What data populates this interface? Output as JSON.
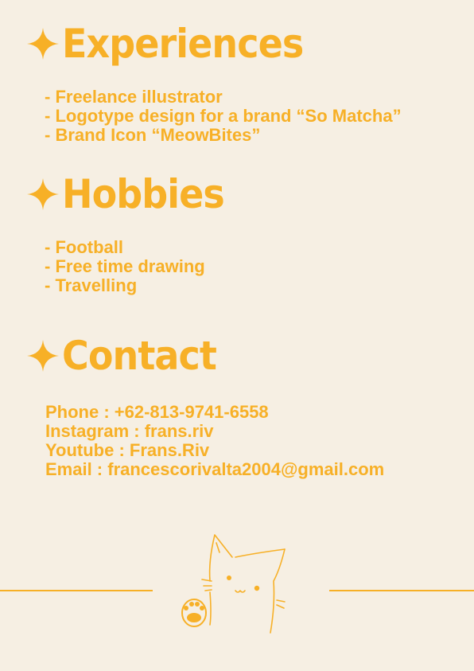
{
  "experiences": {
    "title": "Experiences",
    "items": [
      "- Freelance illustrator",
      "- Logotype design for a brand “So Matcha”",
      "- Brand Icon “MeowBites”"
    ]
  },
  "hobbies": {
    "title": "Hobbies",
    "items": [
      "- Football",
      "- Free time drawing",
      "- Travelling"
    ]
  },
  "contact": {
    "title": "Contact",
    "phone": "Phone : +62-813-9741-6558",
    "instagram": "Instagram : frans.riv",
    "youtube": "Youtube : Frans.Riv",
    "email": "Email : francescorivalta2004@gmail.com"
  },
  "colors": {
    "background": "#f6efe3",
    "accent": "#f7b027"
  },
  "icons": {
    "sparkle": "four-point-star-icon",
    "illustration": "cat-with-paw-illustration"
  }
}
